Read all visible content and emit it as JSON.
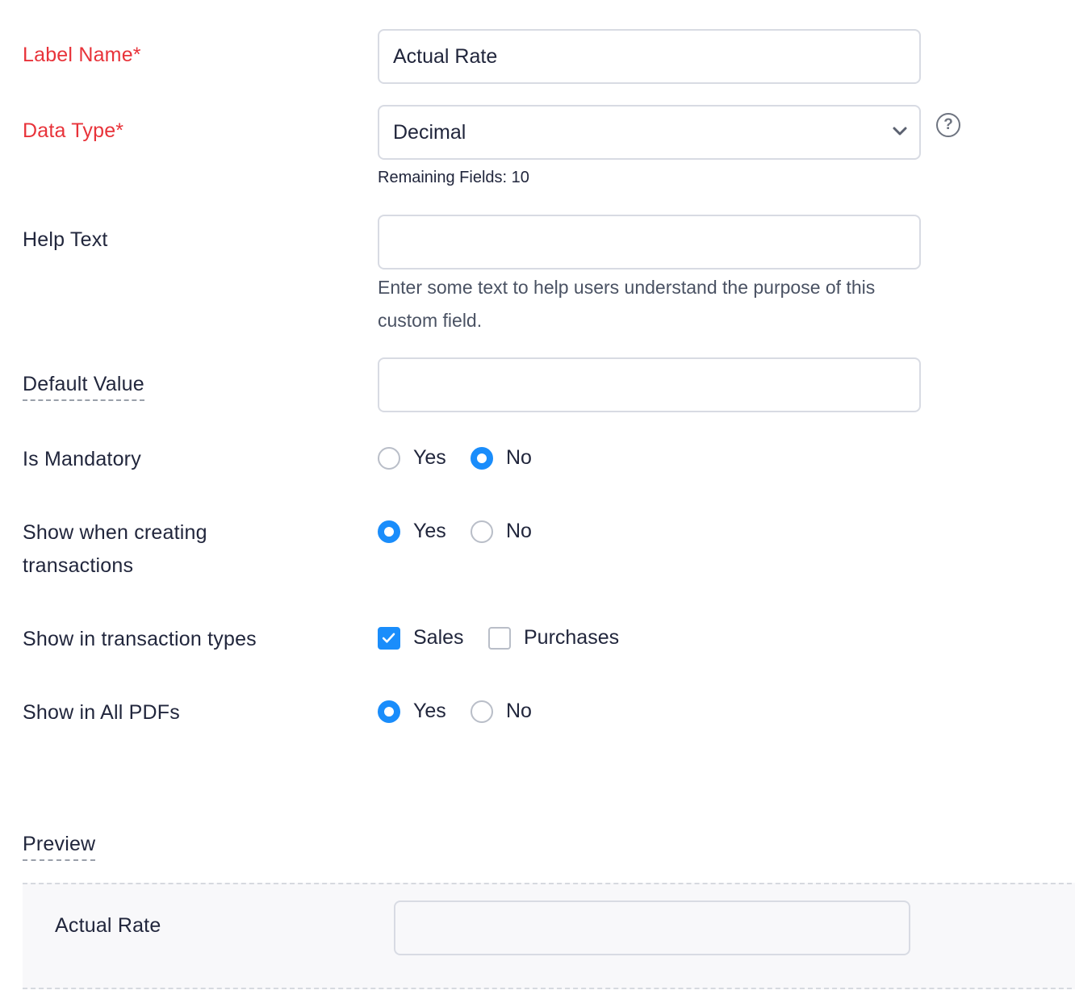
{
  "form": {
    "label_name": {
      "label": "Label Name*",
      "value": "Actual Rate"
    },
    "data_type": {
      "label": "Data Type*",
      "value": "Decimal",
      "help_icon": "help-circle-icon",
      "remaining": "Remaining Fields: 10"
    },
    "help_text": {
      "label": "Help Text",
      "value": "",
      "hint": "Enter some text to help users understand the purpose of this custom field."
    },
    "default_value": {
      "label": "Default Value",
      "value": ""
    },
    "is_mandatory": {
      "label": "Is Mandatory",
      "options": [
        "Yes",
        "No"
      ],
      "selected": "No"
    },
    "show_when_creating": {
      "label_line1": "Show when creating",
      "label_line2": "transactions",
      "options": [
        "Yes",
        "No"
      ],
      "selected": "Yes"
    },
    "show_in_types": {
      "label": "Show in transaction types",
      "options": [
        "Sales",
        "Purchases"
      ],
      "checked": [
        "Sales"
      ]
    },
    "show_in_pdfs": {
      "label": "Show in All PDFs",
      "options": [
        "Yes",
        "No"
      ],
      "selected": "Yes"
    }
  },
  "preview": {
    "title": "Preview",
    "field_label": "Actual Rate",
    "field_value": ""
  },
  "colors": {
    "required_label": "#e8333a",
    "accent": "#1a8dfb",
    "border": "#d8dbe3"
  }
}
